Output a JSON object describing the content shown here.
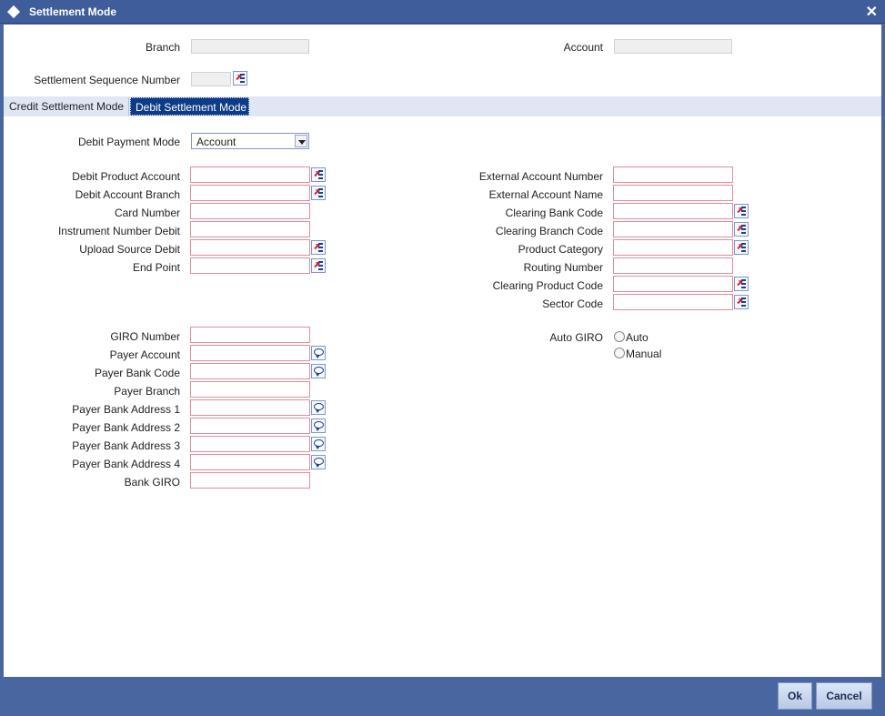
{
  "window": {
    "title": "Settlement Mode"
  },
  "header": {
    "branch_label": "Branch",
    "account_label": "Account",
    "settlement_seq_label": "Settlement Sequence Number"
  },
  "tabs": [
    {
      "label": "Credit Settlement Mode"
    },
    {
      "label": "Debit Settlement Mode"
    }
  ],
  "debit_payment_mode": {
    "label": "Debit Payment Mode",
    "value": "Account"
  },
  "left_fields": {
    "debit_product_account": "Debit Product Account",
    "debit_account_branch": "Debit Account Branch",
    "card_number": "Card Number",
    "instrument_number_debit": "Instrument Number Debit",
    "upload_source_debit": "Upload Source Debit",
    "end_point": "End Point"
  },
  "right_fields": {
    "external_account_number": "External Account Number",
    "external_account_name": "External Account Name",
    "clearing_bank_code": "Clearing Bank Code",
    "clearing_branch_code": "Clearing Branch Code",
    "product_category": "Product Category",
    "routing_number": "Routing Number",
    "clearing_product_code": "Clearing Product Code",
    "sector_code": "Sector Code"
  },
  "giro": {
    "giro_number": "GIRO Number",
    "payer_account": "Payer Account",
    "payer_bank_code": "Payer Bank Code",
    "payer_branch": "Payer Branch",
    "payer_bank_address_1": "Payer Bank Address 1",
    "payer_bank_address_2": "Payer Bank Address 2",
    "payer_bank_address_3": "Payer Bank Address 3",
    "payer_bank_address_4": "Payer Bank Address 4",
    "bank_giro": "Bank GIRO"
  },
  "auto_giro": {
    "label": "Auto GIRO",
    "option_auto": "Auto",
    "option_manual": "Manual"
  },
  "footer": {
    "ok_label": "Ok",
    "cancel_label": "Cancel"
  }
}
